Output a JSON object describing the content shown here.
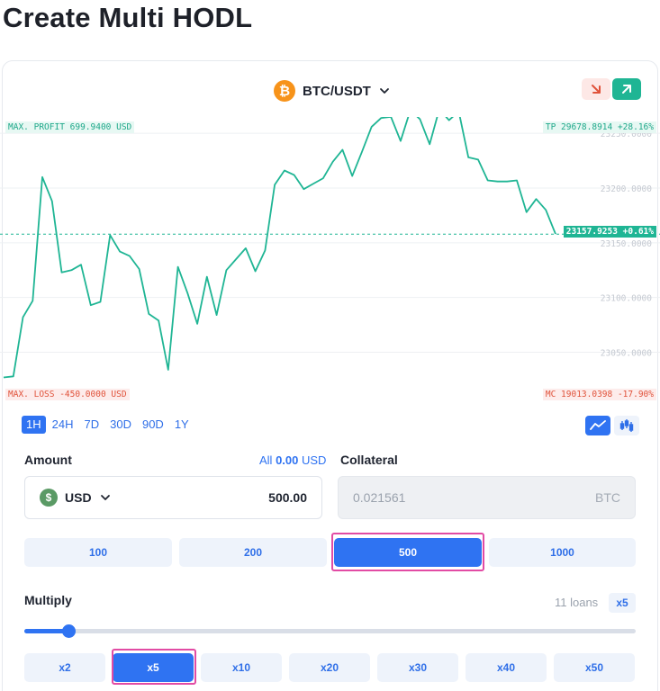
{
  "page": {
    "title": "Create Multi HODL"
  },
  "pair": {
    "label": "BTC/USDT",
    "icon": "bitcoin-icon"
  },
  "direction": {
    "down_icon": "arrow-down-right-icon",
    "up_icon": "arrow-up-right-icon",
    "down_color": "#e0523a",
    "up_color": "#1fb594"
  },
  "chart_tags": {
    "max_profit": "MAX. PROFIT 699.9400 USD",
    "take_profit": "TP 29678.8914 +28.16%",
    "max_loss": "MAX. LOSS -450.0000 USD",
    "margin_call": "MC 19013.0398 -17.90%",
    "current_price": "23157.9253 +0.61%"
  },
  "chart_data": {
    "type": "line",
    "ylim": [
      23020,
      23260
    ],
    "yticks": [
      "23250.0000",
      "23200.0000",
      "23150.0000",
      "23100.0000",
      "23050.0000"
    ],
    "current_price": 23157.9253,
    "values": [
      23027,
      23028,
      23082,
      23097,
      23210,
      23188,
      23123,
      23125,
      23130,
      23093,
      23096,
      23157,
      23142,
      23138,
      23126,
      23085,
      23079,
      23034,
      23128,
      23104,
      23076,
      23119,
      23084,
      23125,
      23135,
      23145,
      23124,
      23143,
      23203,
      23216,
      23212,
      23199,
      23204,
      23209,
      23224,
      23235,
      23211,
      23233,
      23256,
      23264,
      23265,
      23243,
      23271,
      23263,
      23240,
      23272,
      23262,
      23270,
      23228,
      23226,
      23207,
      23206,
      23206,
      23207,
      23178,
      23190,
      23180,
      23158
    ],
    "line_color": "#1fb594",
    "grid": true
  },
  "timeframes": [
    {
      "label": "1H",
      "active": true
    },
    {
      "label": "24H",
      "active": false
    },
    {
      "label": "7D",
      "active": false
    },
    {
      "label": "30D",
      "active": false
    },
    {
      "label": "90D",
      "active": false
    },
    {
      "label": "1Y",
      "active": false
    }
  ],
  "chart_type": {
    "line_icon": "line-chart-icon",
    "candle_icon": "candlestick-chart-icon"
  },
  "amount": {
    "label": "Amount",
    "all_prefix": "All ",
    "all_value": "0.00",
    "all_suffix": " USD",
    "currency": "USD",
    "value": "500.00"
  },
  "collateral": {
    "label": "Collateral",
    "value": "0.021561",
    "unit": "BTC"
  },
  "presets": [
    {
      "label": "100",
      "selected": false
    },
    {
      "label": "200",
      "selected": false
    },
    {
      "label": "500",
      "selected": true
    },
    {
      "label": "1000",
      "selected": false
    }
  ],
  "multiply": {
    "label": "Multiply",
    "loans": "11 loans",
    "current": "x5",
    "slider_fraction": 0.072,
    "options": [
      {
        "label": "x2",
        "selected": false
      },
      {
        "label": "x5",
        "selected": true
      },
      {
        "label": "x10",
        "selected": false
      },
      {
        "label": "x20",
        "selected": false
      },
      {
        "label": "x30",
        "selected": false
      },
      {
        "label": "x40",
        "selected": false
      },
      {
        "label": "x50",
        "selected": false
      }
    ]
  },
  "colors": {
    "accent": "#2f73f2",
    "profit": "#1fb594",
    "loss": "#e0523a",
    "highlight": "#e24ba4"
  }
}
